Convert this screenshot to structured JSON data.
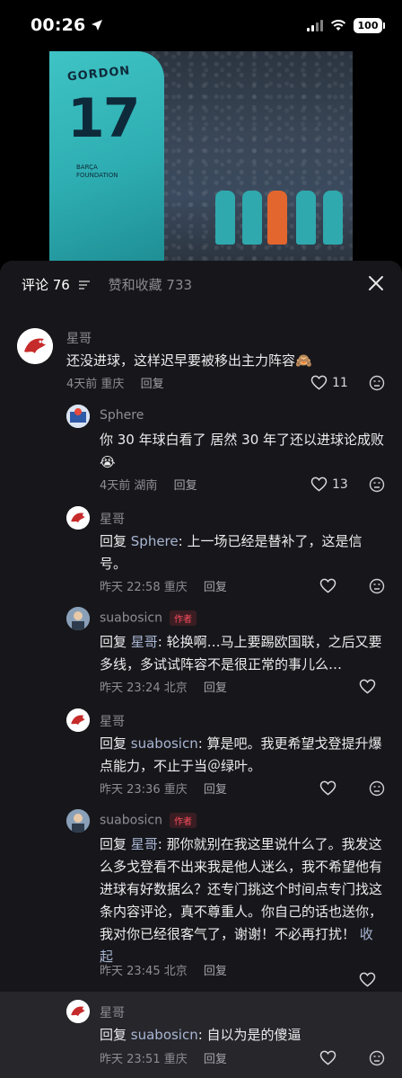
{
  "status": {
    "time": "00:26",
    "battery": "100"
  },
  "video": {
    "jersey_name": "GORDON",
    "jersey_number": "17",
    "jersey_text": "BARÇA\nFOUNDATION"
  },
  "tabs": {
    "comments": "评论 76",
    "likes": "赞和收藏 733"
  },
  "comments": [
    {
      "author": "星哥",
      "text": "还没进球，这样迟早要被移出主力阵容🙈",
      "time": "4天前",
      "location": "重庆",
      "reply": "回复",
      "likes": "11"
    },
    {
      "author": "Sphere",
      "text": "你 30 年球白看了 居然 30 年了还以进球论成败😭",
      "time": "4天前",
      "location": "湖南",
      "reply": "回复",
      "likes": "13"
    },
    {
      "author": "星哥",
      "text_prefix": "回复 ",
      "mention": "Sphere",
      "text": ": 上一场已经是替补了，这是信号。",
      "time": "昨天 22:58",
      "location": "重庆",
      "reply": "回复"
    },
    {
      "author": "suabosicn",
      "tag": "作者",
      "text_prefix": "回复 ",
      "mention": "星哥",
      "text": ": 轮换啊…马上要踢欧国联，之后又要多线，多试试阵容不是很正常的事儿么…",
      "time": "昨天 23:24",
      "location": "北京",
      "reply": "回复"
    },
    {
      "author": "星哥",
      "text_prefix": "回复 ",
      "mention": "suabosicn",
      "text": ": 算是吧。我更希望戈登提升爆点能力，不止于当＠绿叶。",
      "time": "昨天 23:36",
      "location": "重庆",
      "reply": "回复"
    },
    {
      "author": "suabosicn",
      "tag": "作者",
      "text_prefix": "回复 ",
      "mention": "星哥",
      "text": ": 那你就别在我这里说什么了。我发这么多戈登看不出来我是他人迷么，我不希望他有进球有好数据么？还专门挑这个时间点专门找这条内容评论，真不尊重人。你自己的话也送你，我对你已经很客气了，谢谢！不必再打扰！",
      "collapse": "收起",
      "time": "昨天 23:45",
      "location": "北京",
      "reply": "回复"
    },
    {
      "author": "星哥",
      "text_prefix": "回复 ",
      "mention": "suabosicn",
      "text": ": 自以为是的傻逼",
      "time": "昨天 23:51",
      "location": "重庆",
      "reply": "回复"
    }
  ]
}
